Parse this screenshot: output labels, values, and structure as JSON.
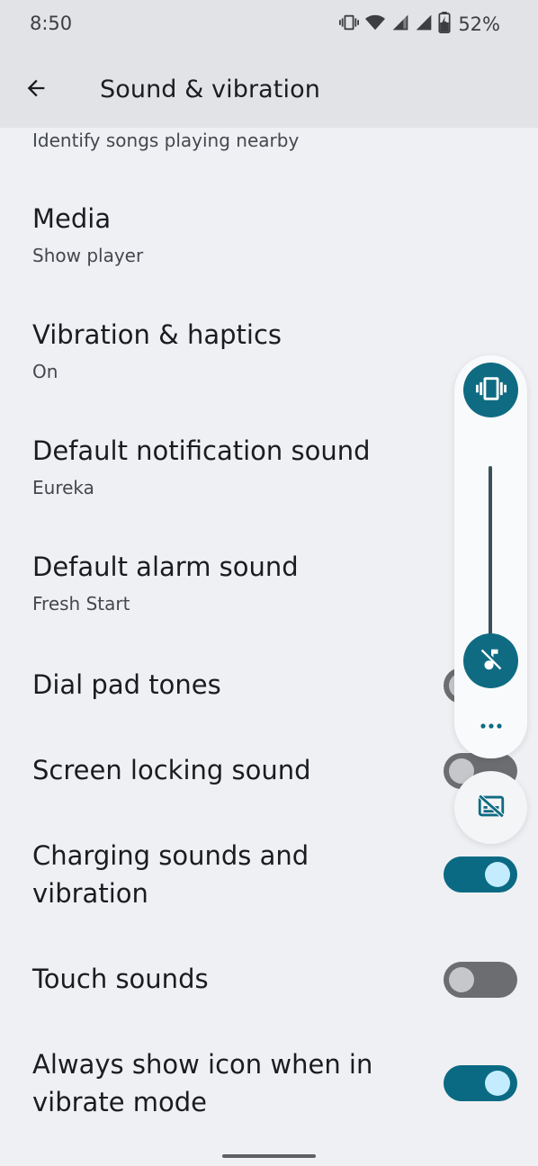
{
  "status_bar": {
    "time": "8:50",
    "battery": "52%",
    "icons": [
      "vibrate-icon",
      "wifi-icon",
      "signal-icon",
      "signal-icon",
      "battery-charging-icon"
    ]
  },
  "app_bar": {
    "title": "Sound & vibration",
    "back_icon": "arrow-back-icon"
  },
  "list": {
    "now_playing_subtitle": "Identify songs playing nearby",
    "media": {
      "title": "Media",
      "subtitle": "Show player"
    },
    "vibration_haptics": {
      "title": "Vibration & haptics",
      "subtitle": "On"
    },
    "notification_sound": {
      "title": "Default notification sound",
      "subtitle": "Eureka"
    },
    "alarm_sound": {
      "title": "Default alarm sound",
      "subtitle": "Fresh Start"
    },
    "dial_pad_tones": {
      "title": "Dial pad tones",
      "checked": false
    },
    "screen_locking_sound": {
      "title": "Screen locking sound",
      "checked": false
    },
    "charging_sounds": {
      "title_line1": "Charging sounds and",
      "title_line2": "vibration",
      "checked": true
    },
    "touch_sounds": {
      "title": "Touch sounds",
      "checked": false
    },
    "always_show_icon": {
      "title_line1": "Always show icon when in",
      "title_line2": "vibrate mode",
      "checked": true
    }
  },
  "volume_panel": {
    "ringer_mode_icon": "vibrate-icon",
    "slider_icon": "music-off-icon",
    "more_icon": "more-horiz-icon",
    "captions_icon": "captions-off-icon",
    "level": 0
  },
  "colors": {
    "accent": "#0f6b82",
    "toggle_on_track": "#0a6a84",
    "toggle_on_knob": "#c3ecfe",
    "toggle_off_track": "#6b6d71",
    "background": "#eff0f3",
    "app_bar": "#e2e3e6"
  }
}
